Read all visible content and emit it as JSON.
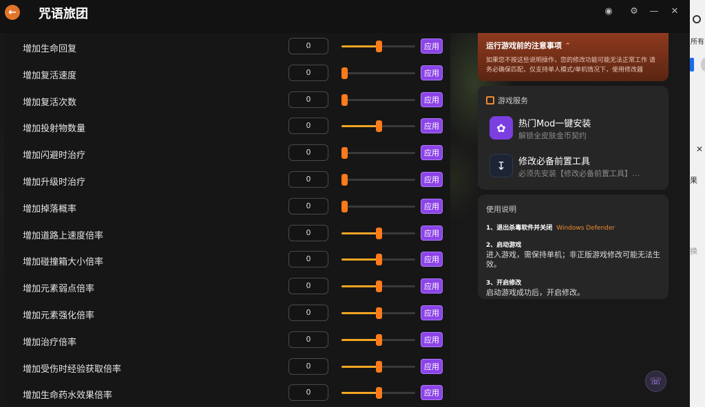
{
  "app": {
    "title": "咒语旅团"
  },
  "icons": {
    "back": "back-arrow-icon",
    "window_buttons": [
      "account-icon",
      "settings-icon",
      "minimize-icon",
      "collapse-icon"
    ],
    "support": "headset-icon"
  },
  "colors": {
    "accent_orange": "#ff7a1a",
    "apply_purple": "#8c44e8",
    "notice_red": "#8e3a1e"
  },
  "cheats": {
    "apply_label": "应用",
    "rows": [
      {
        "label": "增加生命回复",
        "value": "0",
        "level": 0.5
      },
      {
        "label": "增加复活速度",
        "value": "0",
        "level": 0
      },
      {
        "label": "增加复活次数",
        "value": "0",
        "level": 0
      },
      {
        "label": "增加投射物数量",
        "value": "0",
        "level": 0.5
      },
      {
        "label": "增加闪避时治疗",
        "value": "0",
        "level": 0
      },
      {
        "label": "增加升级时治疗",
        "value": "0",
        "level": 0
      },
      {
        "label": "增加掉落概率",
        "value": "0",
        "level": 0
      },
      {
        "label": "增加道路上速度倍率",
        "value": "0",
        "level": 0.5
      },
      {
        "label": "增加碰撞箱大小倍率",
        "value": "0",
        "level": 0.5
      },
      {
        "label": "增加元素弱点倍率",
        "value": "0",
        "level": 0.5
      },
      {
        "label": "增加元素强化倍率",
        "value": "0",
        "level": 0.5
      },
      {
        "label": "增加治疗倍率",
        "value": "0",
        "level": 0.5
      },
      {
        "label": "增加受伤时经验获取倍率",
        "value": "0",
        "level": 0.5
      },
      {
        "label": "增加生命药水效果倍率",
        "value": "0",
        "level": 0.5
      }
    ]
  },
  "notice": {
    "title": "运行游戏前的注意事项",
    "body": "如果您不按这些说明操作，您的修改功能可能无法正常工作 请务必确保匹配，仅支持单人模式/单机情况下，使用修改器"
  },
  "services": {
    "header": "游戏服务",
    "items": [
      {
        "title": "热门Mod一键安装",
        "subtitle": "解锁全皮肤金币契约",
        "icon": "mod-flower-icon"
      },
      {
        "title": "修改必备前置工具",
        "subtitle": "必须先安装【修改必备前置工具】…",
        "icon": "download-icon"
      }
    ]
  },
  "usage": {
    "title": "使用说明",
    "steps": [
      {
        "head": "1、退出杀毒软件并关闭",
        "highlight": "Windows Defender",
        "body": ""
      },
      {
        "head": "2、启动游戏",
        "highlight": "",
        "body": "进入游戏，需保持单机；非正版游戏修改可能无法生效。"
      },
      {
        "head": "3、开启修改",
        "highlight": "",
        "body": "启动游戏成功后，开启修改。"
      }
    ]
  },
  "side_strip": {
    "texts": [
      "所有",
      "果",
      "换"
    ]
  }
}
